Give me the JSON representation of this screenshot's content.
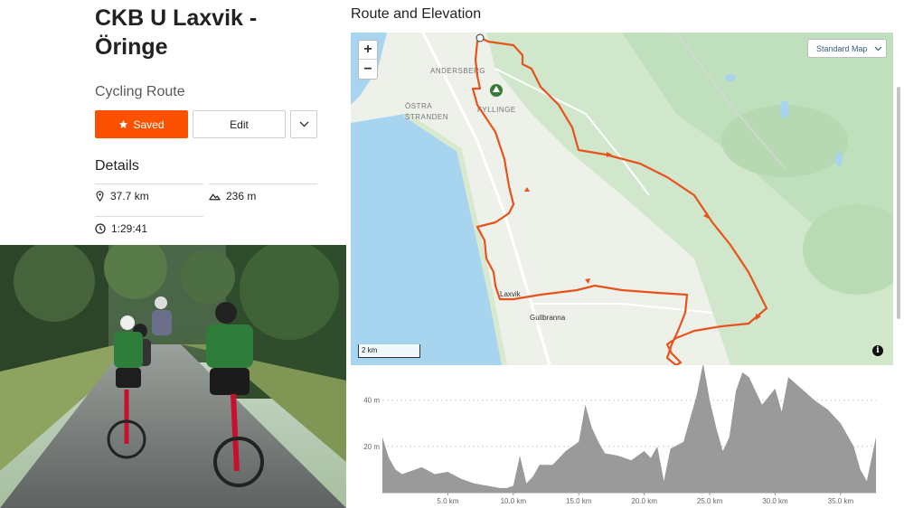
{
  "route": {
    "title": "CKB U Laxvik - Öringe",
    "type": "Cycling Route"
  },
  "actions": {
    "saved_label": "Saved",
    "edit_label": "Edit",
    "more_icon": "chevron-down-icon"
  },
  "details": {
    "heading": "Details",
    "distance": "37.7 km",
    "elevation_gain": "236 m",
    "est_time": "1:29:41"
  },
  "map": {
    "section_title": "Route and Elevation",
    "zoom_in": "+",
    "zoom_out": "−",
    "style_select": "Standard Map",
    "scale_label": "2 km",
    "info_label": "i",
    "route_color": "#e8521b",
    "places": [
      "ANDERSBERG",
      "FYLLINGE",
      "ÖSTRA",
      "STRANDEN",
      "Laxvik",
      "Gullbranna"
    ]
  },
  "chart_data": {
    "type": "area",
    "title": "",
    "xlabel": "",
    "ylabel": "",
    "xlim": [
      0,
      37.7
    ],
    "ylim": [
      0,
      52
    ],
    "x_ticks": [
      "5.0 km",
      "10.0 km",
      "15.0 km",
      "20.0 km",
      "25.0 km",
      "30.0 km",
      "35.0 km"
    ],
    "x_tick_values": [
      5,
      10,
      15,
      20,
      25,
      30,
      35
    ],
    "y_ticks": [
      "20 m",
      "40 m"
    ],
    "y_tick_values": [
      20,
      40
    ],
    "grid": true,
    "fill_color": "#9a9a9a",
    "x": [
      0,
      0.5,
      1,
      1.5,
      2,
      3,
      4,
      5,
      6,
      7,
      8,
      9,
      9.5,
      10,
      10.5,
      11,
      11.5,
      12,
      13,
      14,
      15,
      15.5,
      16,
      16.5,
      17,
      18,
      19,
      20,
      20.5,
      21,
      21.5,
      22,
      23,
      24,
      24.5,
      25,
      25.5,
      26,
      26.5,
      27,
      27.5,
      28,
      29,
      30,
      30.5,
      31,
      32,
      33,
      34,
      35,
      36,
      36.5,
      37,
      37.7
    ],
    "y": [
      24,
      15,
      10,
      8,
      9,
      11,
      8,
      9,
      6,
      4,
      3,
      2,
      2,
      3,
      16,
      4,
      7,
      12,
      12,
      18,
      22,
      38,
      28,
      22,
      17,
      16,
      14,
      18,
      15,
      20,
      5,
      19,
      22,
      42,
      56,
      40,
      28,
      18,
      24,
      44,
      52,
      50,
      38,
      45,
      35,
      50,
      45,
      40,
      36,
      30,
      20,
      10,
      5,
      24
    ]
  }
}
